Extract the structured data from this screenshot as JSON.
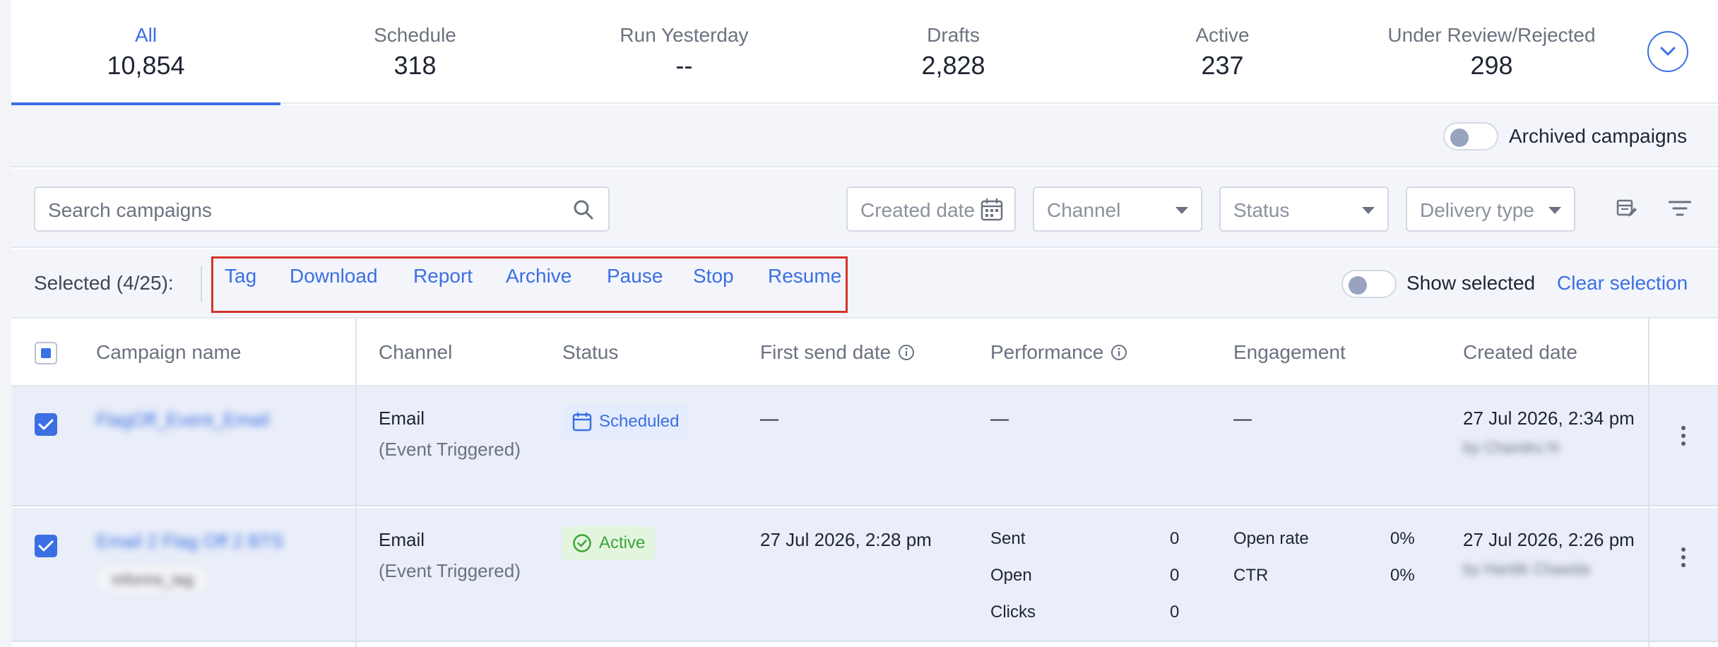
{
  "tabs": [
    {
      "label": "All",
      "count": "10,854",
      "active": true
    },
    {
      "label": "Schedule",
      "count": "318"
    },
    {
      "label": "Run Yesterday",
      "count": "--"
    },
    {
      "label": "Drafts",
      "count": "2,828"
    },
    {
      "label": "Active",
      "count": "237"
    },
    {
      "label": "Under Review/Rejected",
      "count": "298"
    }
  ],
  "archived": {
    "label": "Archived campaigns",
    "on": false
  },
  "filters": {
    "search_placeholder": "Search campaigns",
    "created_date": "Created date",
    "channel": "Channel",
    "status": "Status",
    "delivery_type": "Delivery type"
  },
  "selection": {
    "count_label": "Selected (4/25):",
    "actions": [
      "Tag",
      "Download",
      "Report",
      "Archive",
      "Pause",
      "Stop",
      "Resume"
    ],
    "show_selected_label": "Show selected",
    "clear_label": "Clear selection"
  },
  "table": {
    "headers": {
      "campaign_name": "Campaign name",
      "channel": "Channel",
      "status": "Status",
      "first_send_date": "First send date",
      "performance": "Performance",
      "engagement": "Engagement",
      "created_date": "Created date"
    },
    "rows": [
      {
        "name": "FlagOff_Event_Email",
        "channel": "Email",
        "channel_sub": "(Event Triggered)",
        "status": "Scheduled",
        "first_send": "—",
        "performance": "—",
        "engagement": "—",
        "created": "27 Jul 2026, 2:34 pm",
        "created_by": "by Chandru N"
      },
      {
        "name": "Email 2 Flag Off 2 BTS",
        "tag": "informs_tag",
        "channel": "Email",
        "channel_sub": "(Event Triggered)",
        "status": "Active",
        "first_send": "27 Jul 2026, 2:28 pm",
        "performance": {
          "sent_label": "Sent",
          "sent": "0",
          "open_label": "Open",
          "open": "0",
          "clicks_label": "Clicks",
          "clicks": "0"
        },
        "engagement": {
          "open_rate_label": "Open rate",
          "open_rate": "0%",
          "ctr_label": "CTR",
          "ctr": "0%"
        },
        "created": "27 Jul 2026, 2:26 pm",
        "created_by": "by Hardik Chawda"
      }
    ]
  },
  "colors": {
    "accent": "#3b6fe3",
    "highlight": "#d6332b",
    "active_green": "#3da43a",
    "row_selected_bg": "#e9eef9"
  }
}
